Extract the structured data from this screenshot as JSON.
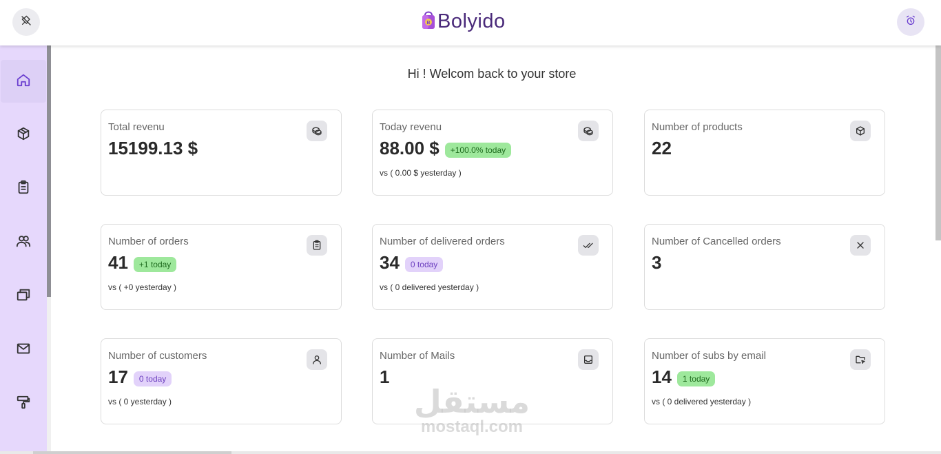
{
  "header": {
    "brand": "Bolyido",
    "left_button_icon": "pin-off-icon",
    "right_button_icon": "alarm-clock-icon"
  },
  "sidebar": {
    "items": [
      {
        "name": "home",
        "icon": "home-icon",
        "active": true
      },
      {
        "name": "products",
        "icon": "package-icon",
        "active": false
      },
      {
        "name": "orders",
        "icon": "clipboard-icon",
        "active": false
      },
      {
        "name": "customers",
        "icon": "users-icon",
        "active": false
      },
      {
        "name": "collections",
        "icon": "windows-icon",
        "active": false
      },
      {
        "name": "mails",
        "icon": "mail-icon",
        "active": false
      },
      {
        "name": "customize",
        "icon": "paint-roller-icon",
        "active": false
      }
    ]
  },
  "main": {
    "welcome": "Hi ! Welcom back to your store",
    "cards": [
      {
        "title": "Total revenu",
        "value": "15199.13 $",
        "badge": "",
        "sub": "",
        "icon": "coins-icon"
      },
      {
        "title": "Today revenu",
        "value": "88.00 $",
        "badge": "+100.0% today",
        "badge_color": "green",
        "sub": "vs ( 0.00 $ yesterday )",
        "icon": "coins-icon"
      },
      {
        "title": "Number of products",
        "value": "22",
        "badge": "",
        "sub": "",
        "icon": "package-icon"
      },
      {
        "title": "Number of orders",
        "value": "41",
        "badge": "+1 today",
        "badge_color": "green",
        "sub": "vs ( +0 yesterday )",
        "icon": "clipboard-icon"
      },
      {
        "title": "Number of delivered orders",
        "value": "34",
        "badge": "0 today",
        "badge_color": "purple",
        "sub": "vs ( 0 delivered yesterday )",
        "icon": "double-check-icon"
      },
      {
        "title": "Number of Cancelled orders",
        "value": "3",
        "badge": "",
        "sub": "",
        "icon": "close-icon"
      },
      {
        "title": "Number of customers",
        "value": "17",
        "badge": "0 today",
        "badge_color": "purple",
        "sub": "vs ( 0 yesterday )",
        "icon": "user-icon"
      },
      {
        "title": "Number of Mails",
        "value": "1",
        "badge": "",
        "sub": "",
        "icon": "inbox-icon"
      },
      {
        "title": "Number of subs by email",
        "value": "14",
        "badge": "1 today",
        "badge_color": "green",
        "sub": "vs ( 0 delivered yesterday )",
        "icon": "folder-cursor-icon"
      }
    ]
  },
  "watermark": {
    "arabic": "مستقل",
    "latin": "mostaql.com"
  },
  "colors": {
    "sidebar_bg": "#e6d8fc",
    "badge_green": "#9ee89c",
    "badge_purple": "#e2d2fa",
    "brand": "#4a2a7a"
  }
}
